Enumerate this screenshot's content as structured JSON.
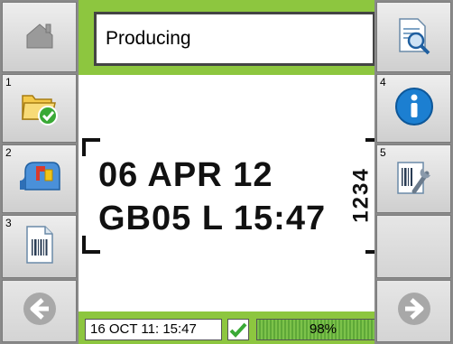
{
  "status": {
    "text": "Producing"
  },
  "left_buttons": [
    {
      "number": "",
      "icon": "home-icon"
    },
    {
      "number": "1",
      "icon": "folder-check-icon"
    },
    {
      "number": "2",
      "icon": "mailbox-icon"
    },
    {
      "number": "3",
      "icon": "barcode-document-icon"
    },
    {
      "number": "",
      "icon": "arrow-left-icon"
    }
  ],
  "right_buttons": [
    {
      "number": "",
      "icon": "document-search-icon"
    },
    {
      "number": "4",
      "icon": "info-icon"
    },
    {
      "number": "5",
      "icon": "barcode-tools-icon"
    },
    {
      "number": "",
      "icon": ""
    },
    {
      "number": "",
      "icon": "arrow-right-icon"
    }
  ],
  "preview": {
    "line1": "06 APR 12",
    "line2": "GB05 L 15:47",
    "vertical_code": "1234"
  },
  "footer": {
    "datetime": "16 OCT 11: 15:47",
    "ok_status": "checked",
    "progress_percent": 98,
    "progress_label": "98%"
  },
  "colors": {
    "panel_green": "#8dc63f",
    "check_green": "#39a935",
    "info_blue": "#1c7fd1",
    "side_gray": "#8a8a8a"
  }
}
